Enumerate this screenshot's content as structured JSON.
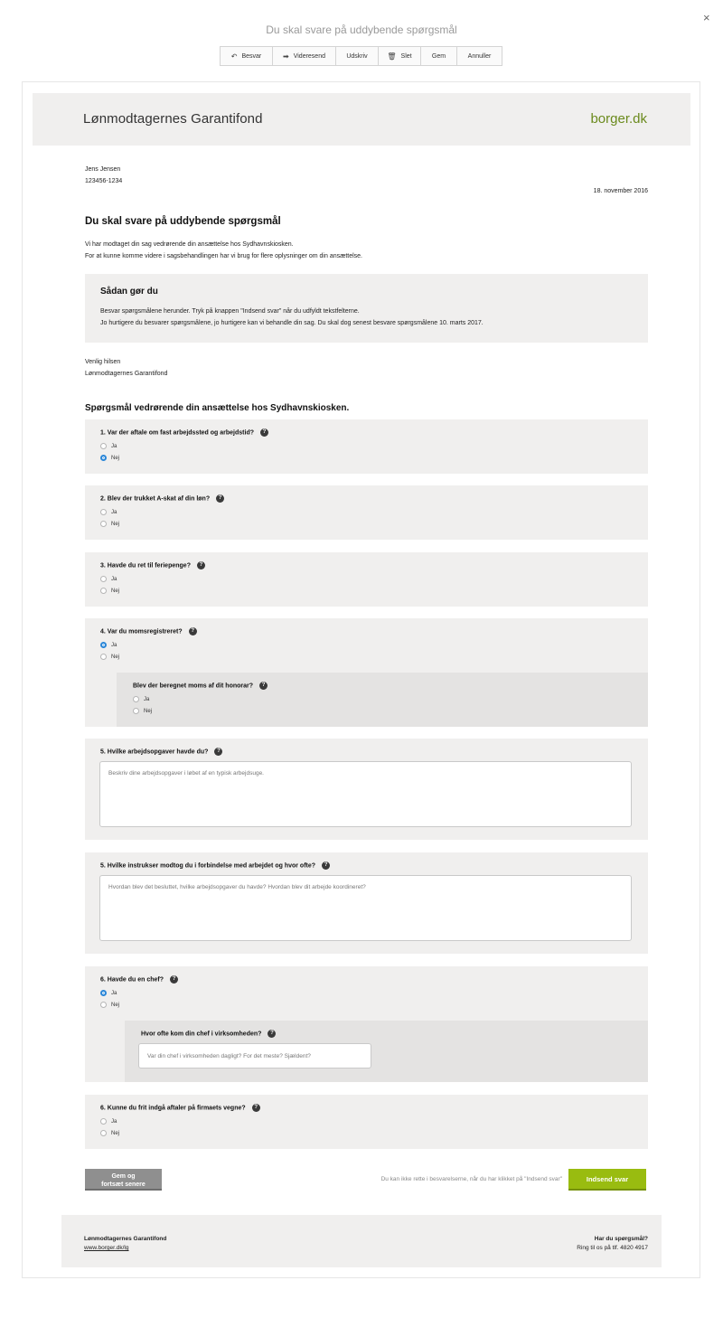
{
  "window": {
    "title": "Du skal svare på uddybende spørgsmål",
    "close": "×"
  },
  "toolbar": [
    {
      "label": "Besvar",
      "icon": "↶"
    },
    {
      "label": "Videresend",
      "icon": "➡"
    },
    {
      "label": "Udskriv",
      "icon": ""
    },
    {
      "label": "Slet",
      "icon": "🗑"
    },
    {
      "label": "Gem",
      "icon": ""
    },
    {
      "label": "Annuller",
      "icon": ""
    }
  ],
  "header": {
    "org": "Lønmodtagernes Garantifond",
    "logo": "borger.dk"
  },
  "recipient": {
    "name": "Jens Jensen",
    "cpr": "123456-1234",
    "date": "18. november 2016"
  },
  "letter": {
    "heading": "Du skal svare på uddybende spørgsmål",
    "p1": "Vi har modtaget din sag vedrørende din ansættelse hos Sydhavnskiosken.",
    "p2": "For at kunne komme videre i sagsbehandlingen har vi brug for flere oplysninger om din ansættelse.",
    "how_heading": "Sådan gør du",
    "how_p1": "Besvar spørgsmålene herunder. Tryk på knappen \"Indsend svar\" når du udfyldt tekstfelterne.",
    "how_p2": "Jo hurtigere du besvarer spørgsmålene, jo hurtigere kan vi behandle din sag. Du skal dog senest besvare spørgsmålene 10. marts 2017.",
    "greeting": "Venlig hilsen",
    "signature": "Lønmodtagernes Garantifond"
  },
  "questions_heading": "Spørgsmål vedrørende din ansættelse hos Sydhavnskiosken.",
  "options": {
    "yes": "Ja",
    "no": "Nej"
  },
  "help_icon": "?",
  "questions": {
    "q1": {
      "label": "1. Var der aftale om fast arbejdssted og arbejdstid?",
      "selected": "Nej"
    },
    "q2": {
      "label": "2. Blev der trukket A-skat af din løn?",
      "selected": ""
    },
    "q3": {
      "label": "3. Havde du ret til feriepenge?",
      "selected": ""
    },
    "q4": {
      "label": "4. Var du momsregistreret?",
      "selected": "Ja"
    },
    "q4sub": {
      "label": "Blev der beregnet moms af dit honorar?",
      "selected": ""
    },
    "q5": {
      "label": "5. Hvilke arbejdsopgaver havde du?",
      "placeholder": "Beskriv dine arbejdsopgaver i løbet af en typisk arbejdsuge."
    },
    "q5b": {
      "label": "5. Hvilke instrukser modtog du i forbindelse med arbejdet og hvor ofte?",
      "placeholder": "Hvordan blev det besluttet, hvilke arbejdsopgaver du havde? Hvordan blev dit arbejde koordineret?"
    },
    "q6": {
      "label": "6. Havde du en chef?",
      "selected": "Ja"
    },
    "q6sub": {
      "label": "Hvor ofte kom din chef i virksomheden?",
      "placeholder": "Var din chef i virksomheden dagligt? For det meste? Sjældent?"
    },
    "q7": {
      "label": "6. Kunne du frit indgå aftaler på firmaets vegne?",
      "selected": ""
    }
  },
  "actions": {
    "save_line1": "Gem og",
    "save_line2": "fortsæt senere",
    "note": "Du kan ikke rette i besvarelserne, når du har klikket på \"Indsend svar\"",
    "submit": "Indsend svar"
  },
  "footer": {
    "org": "Lønmodtagernes Garantifond",
    "link": "www.borger.dk/lg",
    "question": "Har du spørgsmål?",
    "phone": "Ring til os på tlf. 4820 4917"
  },
  "colors": {
    "accent_green": "#99bc10",
    "radio_selected": "#2b87d8",
    "panel_bg": "#f0efee"
  }
}
